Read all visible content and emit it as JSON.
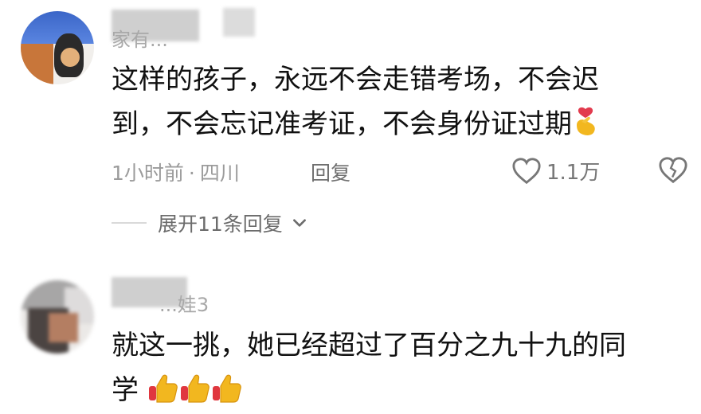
{
  "comments": [
    {
      "username": "家有...",
      "text_line1": "这样的孩子，永远不会走错考场，不会迟",
      "text_line2": "到，不会忘记准考证，不会身份证过期",
      "emoji": "heart-finger-emoji",
      "time": "1小时前",
      "location": "四川",
      "reply_label": "回复",
      "likes": "1.1万",
      "expand_label": "展开11条回复"
    },
    {
      "username": "...娃3",
      "text_line1": "就这一挑，她已经超过了百分之九十九的同",
      "text_line2": "学",
      "emojis": [
        "thumbs-up-emoji",
        "thumbs-up-emoji",
        "thumbs-up-emoji"
      ]
    }
  ],
  "colors": {
    "text": "#111111",
    "meta": "#9b9b9b",
    "accent_heart": "#e23b4e",
    "emoji_yellow": "#f2b71f"
  }
}
